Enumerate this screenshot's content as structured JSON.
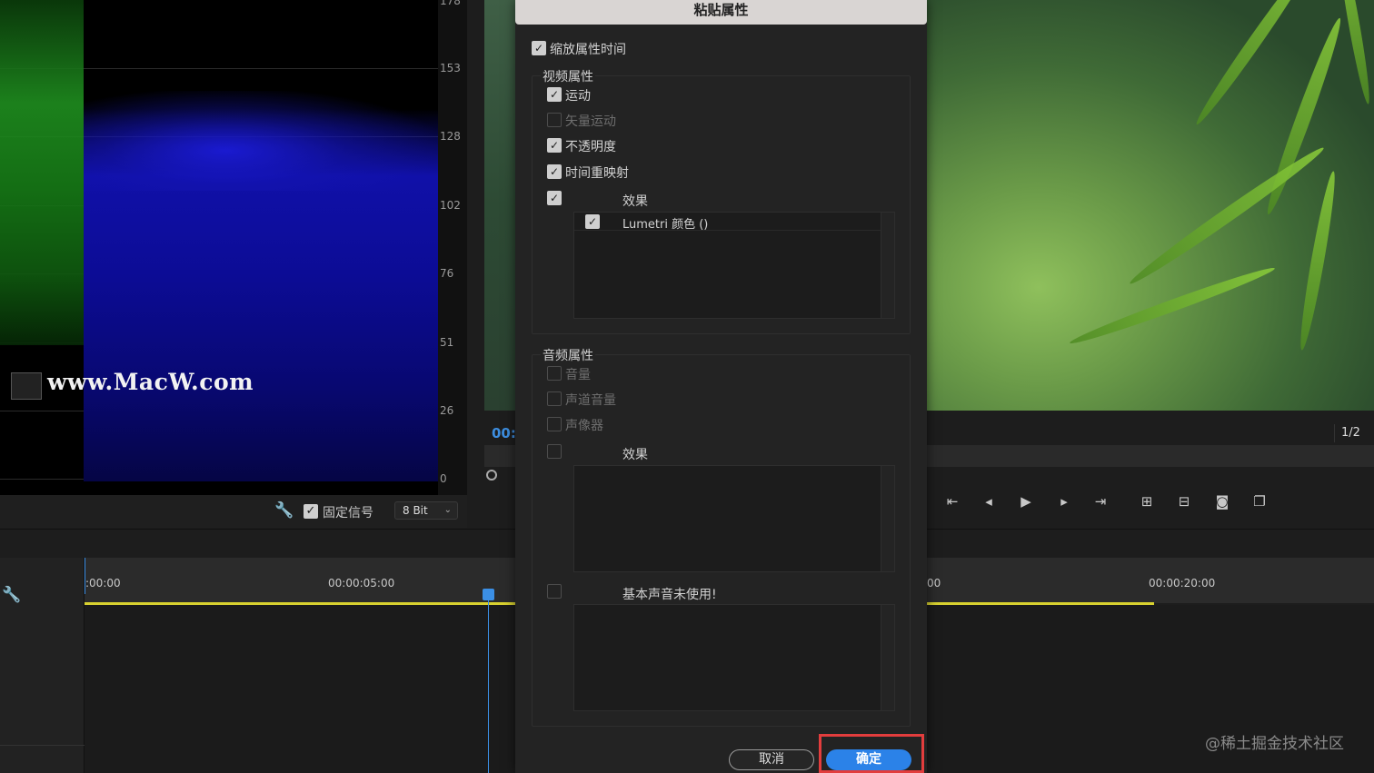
{
  "scope": {
    "scale_labels": [
      "178",
      "153",
      "128",
      "102",
      "76",
      "51",
      "26",
      "0"
    ],
    "watermark": "www.MacW.com",
    "clamp_signal_label": "固定信号",
    "clamp_signal_checked": true,
    "bit_depth": "8 Bit"
  },
  "monitor": {
    "timecode": "00:(",
    "resolution_fraction": "1/2",
    "transport_icons": [
      "step-back-to-in-icon",
      "step-back-icon",
      "play-icon",
      "step-forward-icon",
      "go-to-out-icon",
      "insert-icon",
      "overwrite-icon",
      "export-frame-icon",
      "compare-icon"
    ]
  },
  "timeline": {
    "tc_0": ":00:00",
    "tc_5": "00:00:05:00",
    "tc_15": "00",
    "tc_20": "00:00:20:00",
    "accent_color": "#3b8fe5",
    "work_area_color": "#d8d130"
  },
  "dialog": {
    "title": "粘贴属性",
    "scale_time": {
      "label": "缩放属性时间",
      "checked": true
    },
    "video": {
      "heading": "视频属性",
      "items": [
        {
          "label": "运动",
          "checked": true,
          "enabled": true
        },
        {
          "label": "矢量运动",
          "checked": false,
          "enabled": false
        },
        {
          "label": "不透明度",
          "checked": true,
          "enabled": true
        },
        {
          "label": "时间重映射",
          "checked": true,
          "enabled": true
        }
      ],
      "effects_label": "效果",
      "effects_checked": true,
      "effects_list": [
        {
          "label": "Lumetri 颜色 ()",
          "checked": true
        }
      ]
    },
    "audio": {
      "heading": "音频属性",
      "items": [
        {
          "label": "音量",
          "checked": false,
          "enabled": false
        },
        {
          "label": "声道音量",
          "checked": false,
          "enabled": false
        },
        {
          "label": "声像器",
          "checked": false,
          "enabled": false
        }
      ],
      "effects_label": "效果",
      "effects_checked": false,
      "essential_sound_label": "基本声音未使用!",
      "essential_sound_checked": false
    },
    "cancel_label": "取消",
    "ok_label": "确定",
    "ok_color": "#2b82e8",
    "highlight_color": "#e23d3d"
  },
  "credit": "@稀土掘金技术社区"
}
